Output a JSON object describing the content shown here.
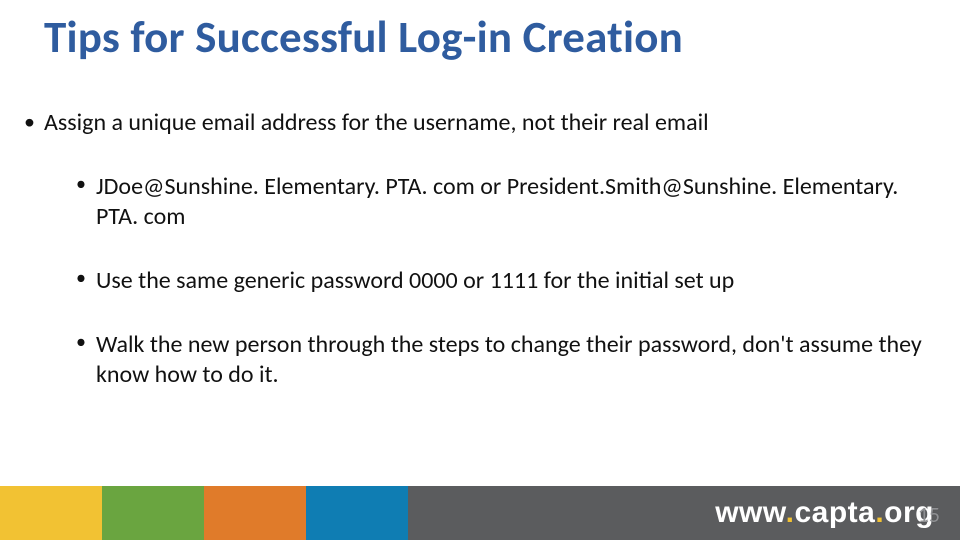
{
  "title": "Tips for Successful Log-in Creation",
  "bullets": {
    "main": "Assign a unique email address for the username, not their real email",
    "sub": [
      "JDoe@Sunshine. Elementary. PTA. com or President.Smith@Sunshine. Elementary. PTA. com",
      "Use the same generic password 0000 or 1111 for the initial set up",
      "Walk the new person through the steps to change their password, don't assume they know how to do it."
    ]
  },
  "footer": {
    "url_prefix": "www",
    "url_mid": "capta",
    "url_suffix": "org"
  },
  "page_number": "15"
}
